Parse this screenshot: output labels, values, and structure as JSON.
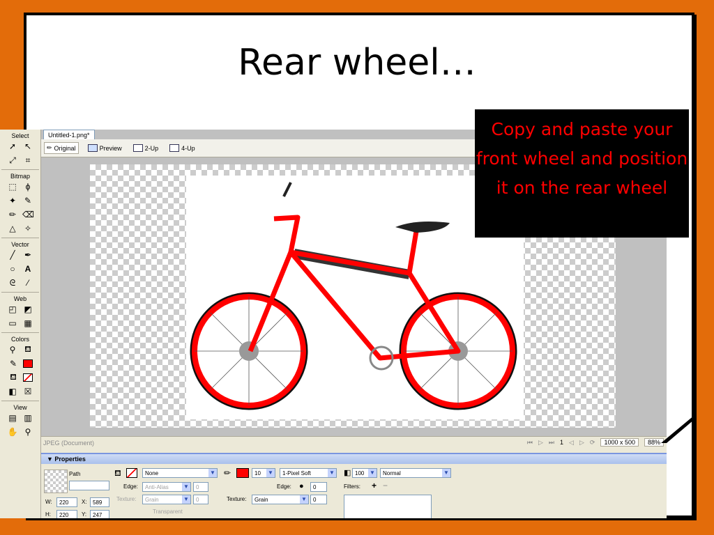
{
  "slide": {
    "title": "Rear wheel…",
    "callout": "Copy and paste your front wheel and position it  on the rear wheel"
  },
  "toolbar": {
    "sections": [
      "Select",
      "Bitmap",
      "Vector",
      "Web",
      "Colors",
      "View"
    ]
  },
  "document": {
    "tab": "Untitled-1.png*",
    "views": [
      "Original",
      "Preview",
      "2-Up",
      "4-Up"
    ],
    "status_left": "JPEG (Document)",
    "frame": "1",
    "size": "1000 x 500",
    "zoom": "88%"
  },
  "properties": {
    "header": "▼ Properties",
    "object_type": "Path",
    "fill": "None",
    "edge_label": "Edge:",
    "edge_value": "Anti-Alias",
    "edge_num": "0",
    "texture_label": "Texture:",
    "texture_value": "Grain",
    "texture_num": "0",
    "transparent": "Transparent",
    "stroke_size": "10",
    "stroke_type": "1-Pixel Soft",
    "stroke_edge_label": "Edge:",
    "stroke_edge_num": "0",
    "stroke_texture_label": "Texture:",
    "stroke_texture_value": "Grain",
    "stroke_texture_num": "0",
    "opacity": "100",
    "blend": "Normal",
    "filters_label": "Filters:",
    "w_label": "W:",
    "w": "220",
    "x_label": "X:",
    "x": "589",
    "h_label": "H:",
    "h": "220",
    "y_label": "Y:",
    "y": "247"
  },
  "colors": {
    "stroke": "#ff0000",
    "accent_bg": "#e36c0a"
  }
}
